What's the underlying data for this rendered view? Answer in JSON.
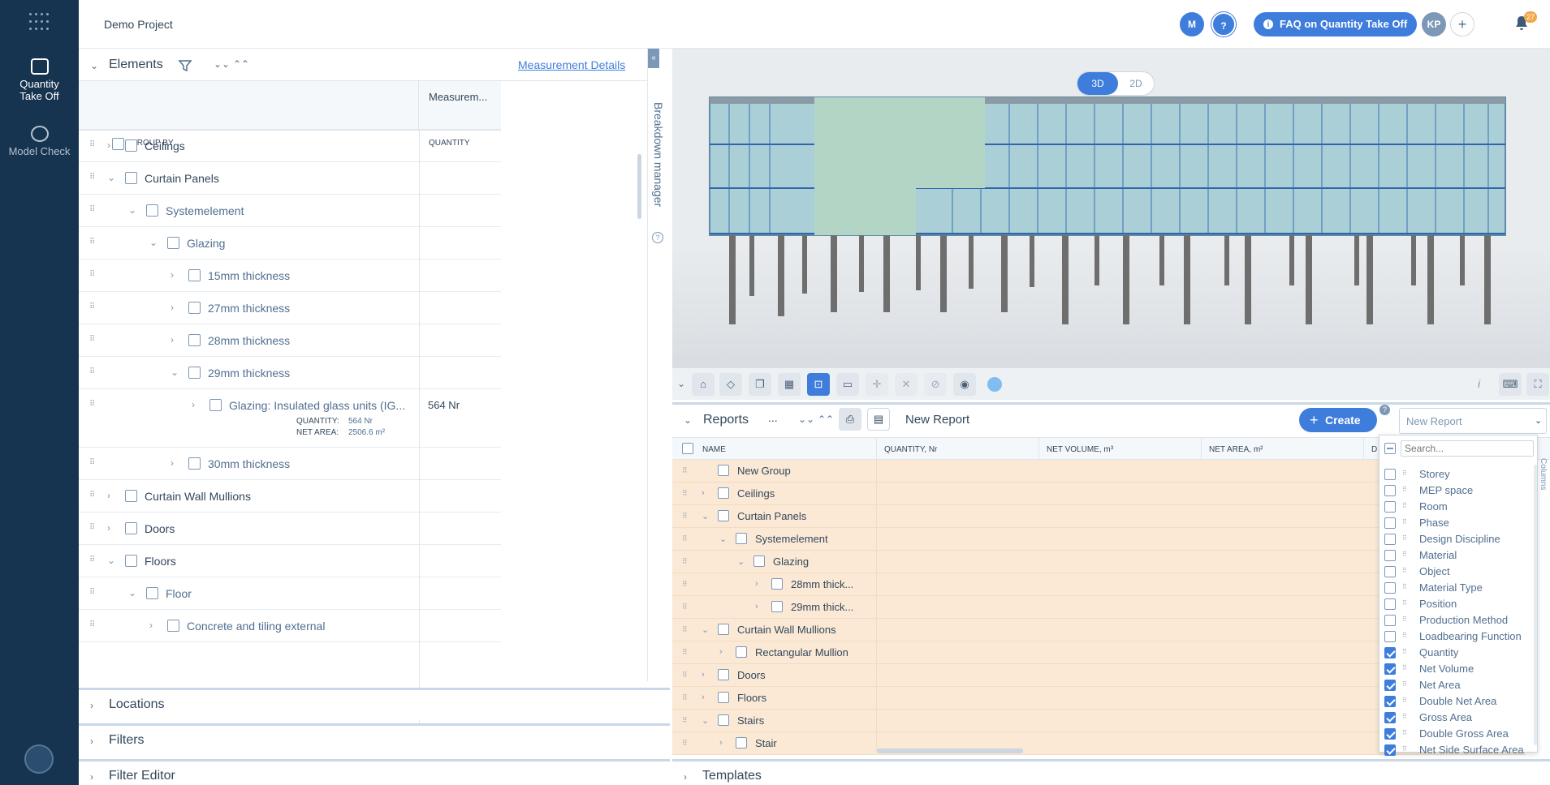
{
  "sidebar": {
    "items": [
      {
        "label": "Quantity Take Off",
        "line1": "Quantity",
        "line2": "Take Off",
        "icon": "quantity-icon"
      },
      {
        "label": "Model Check",
        "icon": "check-icon"
      }
    ]
  },
  "header": {
    "project": "Demo Project",
    "user_m": "M",
    "help": "?",
    "faq": "FAQ on Quantity Take Off",
    "user_kp": "KP",
    "add": "+",
    "notifications": "27"
  },
  "elements": {
    "title": "Elements",
    "measurement_link": "Measurement Details",
    "col_measurement": "Measurem...",
    "col_groupby": "GROUP BY",
    "col_quantity": "QUANTITY",
    "rows": [
      {
        "label": "Ceilings",
        "expanded": false,
        "level": 0
      },
      {
        "label": "Curtain Panels",
        "expanded": true,
        "level": 0
      },
      {
        "label": "Systemelement",
        "expanded": true,
        "level": 1
      },
      {
        "label": "Glazing",
        "expanded": true,
        "level": 2
      },
      {
        "label": "15mm thickness",
        "expanded": false,
        "level": 3
      },
      {
        "label": "27mm thickness",
        "expanded": false,
        "level": 3
      },
      {
        "label": "28mm thickness",
        "expanded": false,
        "level": 3
      },
      {
        "label": "29mm thickness",
        "expanded": true,
        "level": 3
      },
      {
        "label": "Glazing: Insulated glass units (IG...",
        "expanded": false,
        "level": 4,
        "quantity": "564 Nr",
        "detail_qty_label": "QUANTITY:",
        "detail_qty": "564 Nr",
        "detail_area_label": "NET AREA:",
        "detail_area": "2506.6 m²"
      },
      {
        "label": "30mm thickness",
        "expanded": false,
        "level": 3
      },
      {
        "label": "Curtain Wall Mullions",
        "expanded": false,
        "level": 0
      },
      {
        "label": "Doors",
        "expanded": false,
        "level": 0
      },
      {
        "label": "Floors",
        "expanded": true,
        "level": 0
      },
      {
        "label": "Floor",
        "expanded": true,
        "level": 1
      },
      {
        "label": "Concrete and tiling external",
        "expanded": false,
        "level": 2
      }
    ]
  },
  "breakdown": {
    "label": "Breakdown manager"
  },
  "sections": {
    "locations": "Locations",
    "filters": "Filters",
    "filter_editor": "Filter Editor",
    "templates": "Templates"
  },
  "viewer": {
    "mode_3d": "3D",
    "mode_2d": "2D",
    "tools": [
      "home-icon",
      "cube-icon",
      "layers-icon",
      "building-icon",
      "fit-icon",
      "measure-icon",
      "target-icon",
      "collapse-icon",
      "hide-icon",
      "eye-icon"
    ],
    "info": "i"
  },
  "reports": {
    "title": "Reports",
    "more": "...",
    "report_name": "New Report",
    "create": "Create",
    "select_value": "New Report",
    "col_name": "NAME",
    "col_quantity": "QUANTITY, Nr",
    "col_volume": "NET VOLUME, m³",
    "col_area": "NET AREA, m²",
    "col_d": "D",
    "rows": [
      {
        "label": "New Group",
        "level": 0,
        "toggle": ""
      },
      {
        "label": "Ceilings",
        "level": 0,
        "toggle": "›"
      },
      {
        "label": "Curtain Panels",
        "level": 0,
        "toggle": "⌄"
      },
      {
        "label": "Systemelement",
        "level": 1,
        "toggle": "⌄"
      },
      {
        "label": "Glazing",
        "level": 2,
        "toggle": "⌄"
      },
      {
        "label": "28mm thick...",
        "level": 3,
        "toggle": "›"
      },
      {
        "label": "29mm thick...",
        "level": 3,
        "toggle": "›"
      },
      {
        "label": "Curtain Wall Mullions",
        "level": 0,
        "toggle": "⌄"
      },
      {
        "label": "Rectangular Mullion",
        "level": 1,
        "toggle": "›"
      },
      {
        "label": "Doors",
        "level": 0,
        "toggle": "›"
      },
      {
        "label": "Floors",
        "level": 0,
        "toggle": "›"
      },
      {
        "label": "Stairs",
        "level": 0,
        "toggle": "⌄"
      },
      {
        "label": "Stair",
        "level": 1,
        "toggle": "›"
      }
    ]
  },
  "columns_dropdown": {
    "placeholder": "Search...",
    "side_label": "Columns",
    "items": [
      {
        "label": "Storey",
        "checked": false
      },
      {
        "label": "MEP space",
        "checked": false
      },
      {
        "label": "Room",
        "checked": false
      },
      {
        "label": "Phase",
        "checked": false
      },
      {
        "label": "Design Discipline",
        "checked": false
      },
      {
        "label": "Material",
        "checked": false
      },
      {
        "label": "Object",
        "checked": false
      },
      {
        "label": "Material Type",
        "checked": false
      },
      {
        "label": "Position",
        "checked": false
      },
      {
        "label": "Production Method",
        "checked": false
      },
      {
        "label": "Loadbearing Function",
        "checked": false
      },
      {
        "label": "Quantity",
        "checked": true
      },
      {
        "label": "Net Volume",
        "checked": true
      },
      {
        "label": "Net Area",
        "checked": true
      },
      {
        "label": "Double Net Area",
        "checked": true
      },
      {
        "label": "Gross Area",
        "checked": true
      },
      {
        "label": "Double Gross Area",
        "checked": true
      },
      {
        "label": "Net Side Surface Area",
        "checked": true
      }
    ]
  }
}
